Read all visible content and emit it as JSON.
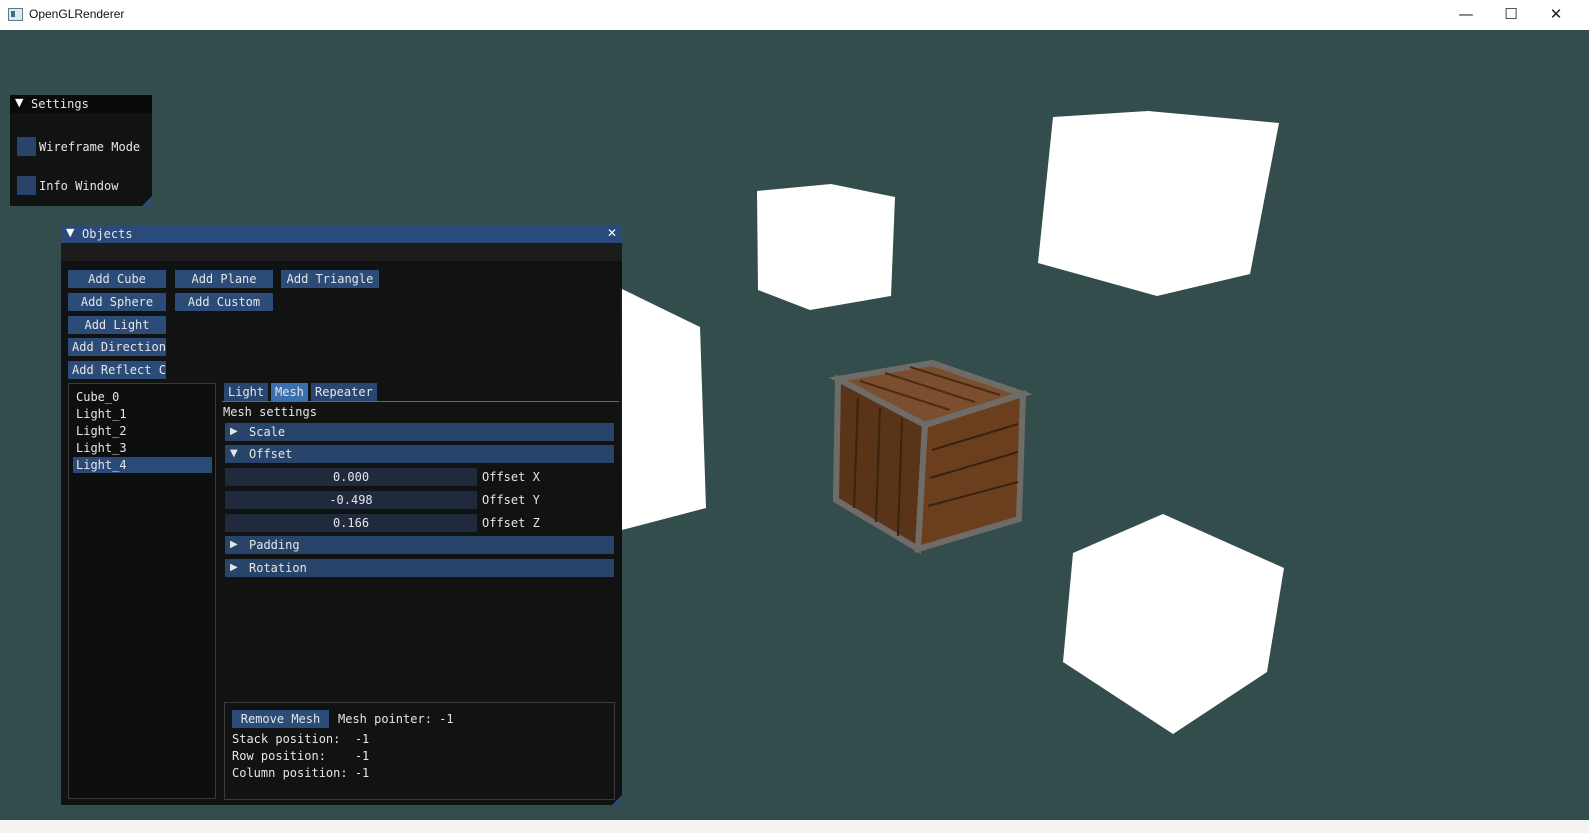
{
  "window": {
    "title": "OpenGLRenderer",
    "minimize_glyph": "—",
    "maximize_glyph": "☐",
    "close_glyph": "✕"
  },
  "settings_window": {
    "title": "Settings",
    "collapse_arrow": "▼",
    "checkboxes": [
      {
        "label": "Wireframe Mode",
        "checked": false
      },
      {
        "label": "Info Window",
        "checked": false
      }
    ]
  },
  "objects_window": {
    "title": "Objects",
    "collapse_arrow": "▼",
    "close_glyph": "✕",
    "add_buttons": {
      "cube": "Add Cube",
      "plane": "Add Plane",
      "triangle": "Add Triangle",
      "sphere": "Add Sphere",
      "custom": "Add Custom",
      "light": "Add Light",
      "directional": "Add Directional",
      "reflect": "Add Reflect Cube"
    },
    "object_list": [
      "Cube_0",
      "Light_1",
      "Light_2",
      "Light_3",
      "Light_4"
    ],
    "selected_object": "Light_4",
    "tabs": [
      "Light",
      "Mesh",
      "Repeater"
    ],
    "active_tab": "Mesh",
    "section_title": "Mesh settings",
    "headers": {
      "scale": "Scale",
      "offset": "Offset",
      "padding": "Padding",
      "rotation": "Rotation"
    },
    "collapsed_arrow": "▶",
    "expanded_arrow": "▼",
    "offset_fields": [
      {
        "value": "0.000",
        "label": "Offset X"
      },
      {
        "value": "-0.498",
        "label": "Offset Y"
      },
      {
        "value": "0.166",
        "label": "Offset Z"
      }
    ],
    "mesh_info": {
      "remove_button": "Remove Mesh",
      "pointer": "Mesh pointer: -1",
      "stack": "Stack position:  -1",
      "row": "Row position:    -1",
      "column": "Column position: -1"
    }
  },
  "colors": {
    "viewport_bg": "#334d4d",
    "button": "#2b4c78",
    "header": "#29446a",
    "title_active": "#294a7a",
    "tab_active": "#3a6fb0"
  }
}
